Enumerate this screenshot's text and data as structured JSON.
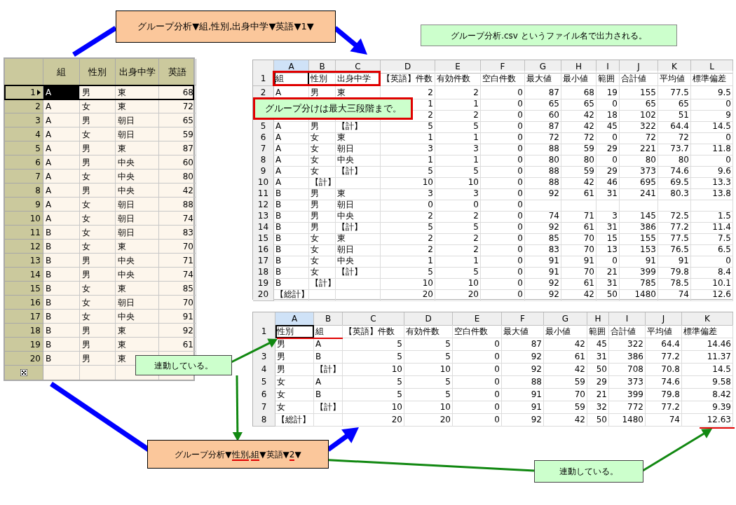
{
  "top_command": {
    "parts": [
      {
        "text": "グループ分析▼組,性別,出身中学▼英語▼1▼",
        "underlined": false
      }
    ]
  },
  "output_note": {
    "text": "グループ分析.csv というファイル名で出力される。"
  },
  "grid": {
    "columns": [
      "組",
      "性別",
      "出身中学",
      "英語"
    ],
    "rows": [
      {
        "number": "1",
        "cells": [
          "A",
          "男",
          "東",
          "68"
        ],
        "selected": true
      },
      {
        "number": "2",
        "cells": [
          "A",
          "女",
          "東",
          "72"
        ],
        "selected": false
      },
      {
        "number": "3",
        "cells": [
          "A",
          "男",
          "朝日",
          "65"
        ],
        "selected": false
      },
      {
        "number": "4",
        "cells": [
          "A",
          "女",
          "朝日",
          "59"
        ],
        "selected": false
      },
      {
        "number": "5",
        "cells": [
          "A",
          "男",
          "東",
          "87"
        ],
        "selected": false
      },
      {
        "number": "6",
        "cells": [
          "A",
          "男",
          "中央",
          "60"
        ],
        "selected": false
      },
      {
        "number": "7",
        "cells": [
          "A",
          "女",
          "中央",
          "80"
        ],
        "selected": false
      },
      {
        "number": "8",
        "cells": [
          "A",
          "男",
          "中央",
          "42"
        ],
        "selected": false
      },
      {
        "number": "9",
        "cells": [
          "A",
          "女",
          "朝日",
          "88"
        ],
        "selected": false
      },
      {
        "number": "10",
        "cells": [
          "A",
          "女",
          "朝日",
          "74"
        ],
        "selected": false
      },
      {
        "number": "11",
        "cells": [
          "B",
          "女",
          "朝日",
          "83"
        ],
        "selected": false
      },
      {
        "number": "12",
        "cells": [
          "B",
          "女",
          "東",
          "70"
        ],
        "selected": false
      },
      {
        "number": "13",
        "cells": [
          "B",
          "男",
          "中央",
          "71"
        ],
        "selected": false
      },
      {
        "number": "14",
        "cells": [
          "B",
          "男",
          "中央",
          "74"
        ],
        "selected": false
      },
      {
        "number": "15",
        "cells": [
          "B",
          "女",
          "東",
          "85"
        ],
        "selected": false
      },
      {
        "number": "16",
        "cells": [
          "B",
          "女",
          "朝日",
          "70"
        ],
        "selected": false
      },
      {
        "number": "17",
        "cells": [
          "B",
          "女",
          "中央",
          "91"
        ],
        "selected": false
      },
      {
        "number": "18",
        "cells": [
          "B",
          "男",
          "東",
          "92"
        ],
        "selected": false
      },
      {
        "number": "19",
        "cells": [
          "B",
          "男",
          "東",
          "61"
        ],
        "selected": false
      },
      {
        "number": "20",
        "cells": [
          "B",
          "男",
          "東",
          null
        ],
        "selected": false
      }
    ]
  },
  "sheet_top": {
    "columns": [
      {
        "label": "A",
        "kind": "text",
        "selected": true
      },
      {
        "label": "B",
        "kind": "text",
        "selected": false
      },
      {
        "label": "C",
        "kind": "text",
        "selected": false
      },
      {
        "label": "D",
        "kind": "number",
        "selected": false
      },
      {
        "label": "E",
        "kind": "number",
        "selected": false
      },
      {
        "label": "F",
        "kind": "number",
        "selected": false
      },
      {
        "label": "G",
        "kind": "number",
        "selected": false
      },
      {
        "label": "H",
        "kind": "number",
        "selected": false
      },
      {
        "label": "I",
        "kind": "number",
        "selected": false
      },
      {
        "label": "J",
        "kind": "number",
        "selected": false
      },
      {
        "label": "K",
        "kind": "number",
        "selected": false
      },
      {
        "label": "L",
        "kind": "number",
        "selected": false
      }
    ],
    "rows": [
      {
        "number": "1",
        "kind": "header",
        "cells": [
          "組",
          "性別",
          "出身中学",
          "【英語】件数",
          "有効件数",
          "空白件数",
          "最大値",
          "最小値",
          "範囲",
          "合計値",
          "平均値",
          "標準偏差"
        ]
      },
      {
        "number": "2",
        "kind": "data",
        "cells": [
          "A",
          "男",
          "東",
          "2",
          "2",
          "0",
          "87",
          "68",
          "19",
          "155",
          "77.5",
          "9.5"
        ]
      },
      {
        "number": null,
        "kind": "data",
        "cells": [
          null,
          null,
          null,
          "1",
          "1",
          "0",
          "65",
          "65",
          "0",
          "65",
          "65",
          "0"
        ]
      },
      {
        "number": null,
        "kind": "data",
        "cells": [
          null,
          null,
          null,
          "2",
          "2",
          "0",
          "60",
          "42",
          "18",
          "102",
          "51",
          "9"
        ]
      },
      {
        "number": "5",
        "kind": "data",
        "cells": [
          "A",
          "男",
          "【計】",
          "5",
          "5",
          "0",
          "87",
          "42",
          "45",
          "322",
          "64.4",
          "14.5"
        ]
      },
      {
        "number": "6",
        "kind": "data",
        "cells": [
          "A",
          "女",
          "東",
          "1",
          "1",
          "0",
          "72",
          "72",
          "0",
          "72",
          "72",
          "0"
        ]
      },
      {
        "number": "7",
        "kind": "data",
        "cells": [
          "A",
          "女",
          "朝日",
          "3",
          "3",
          "0",
          "88",
          "59",
          "29",
          "221",
          "73.7",
          "11.8"
        ]
      },
      {
        "number": "8",
        "kind": "data",
        "cells": [
          "A",
          "女",
          "中央",
          "1",
          "1",
          "0",
          "80",
          "80",
          "0",
          "80",
          "80",
          "0"
        ]
      },
      {
        "number": "9",
        "kind": "data",
        "cells": [
          "A",
          "女",
          "【計】",
          "5",
          "5",
          "0",
          "88",
          "59",
          "29",
          "373",
          "74.6",
          "9.6"
        ]
      },
      {
        "number": "10",
        "kind": "data",
        "cells": [
          "A",
          "【計】",
          null,
          "10",
          "10",
          "0",
          "88",
          "42",
          "46",
          "695",
          "69.5",
          "13.3"
        ]
      },
      {
        "number": "11",
        "kind": "data",
        "cells": [
          "B",
          "男",
          "東",
          "3",
          "3",
          "0",
          "92",
          "61",
          "31",
          "241",
          "80.3",
          "13.8"
        ]
      },
      {
        "number": "12",
        "kind": "data",
        "cells": [
          "B",
          "男",
          "朝日",
          "0",
          "0",
          "0",
          null,
          null,
          null,
          null,
          null,
          null
        ]
      },
      {
        "number": "13",
        "kind": "data",
        "cells": [
          "B",
          "男",
          "中央",
          "2",
          "2",
          "0",
          "74",
          "71",
          "3",
          "145",
          "72.5",
          "1.5"
        ]
      },
      {
        "number": "14",
        "kind": "data",
        "cells": [
          "B",
          "男",
          "【計】",
          "5",
          "5",
          "0",
          "92",
          "61",
          "31",
          "386",
          "77.2",
          "11.4"
        ]
      },
      {
        "number": "15",
        "kind": "data",
        "cells": [
          "B",
          "女",
          "東",
          "2",
          "2",
          "0",
          "85",
          "70",
          "15",
          "155",
          "77.5",
          "7.5"
        ]
      },
      {
        "number": "16",
        "kind": "data",
        "cells": [
          "B",
          "女",
          "朝日",
          "2",
          "2",
          "0",
          "83",
          "70",
          "13",
          "153",
          "76.5",
          "6.5"
        ]
      },
      {
        "number": "17",
        "kind": "data",
        "cells": [
          "B",
          "女",
          "中央",
          "1",
          "1",
          "0",
          "91",
          "91",
          "0",
          "91",
          "91",
          "0"
        ]
      },
      {
        "number": "18",
        "kind": "data",
        "cells": [
          "B",
          "女",
          "【計】",
          "5",
          "5",
          "0",
          "91",
          "70",
          "21",
          "399",
          "79.8",
          "8.4"
        ]
      },
      {
        "number": "19",
        "kind": "data",
        "cells": [
          "B",
          "【計】",
          null,
          "10",
          "10",
          "0",
          "92",
          "61",
          "31",
          "785",
          "78.5",
          "10.1"
        ]
      },
      {
        "number": "20",
        "kind": "data",
        "cells": [
          "【総計】",
          null,
          null,
          "20",
          "20",
          "0",
          "92",
          "42",
          "50",
          "1480",
          "74",
          "12.6"
        ]
      }
    ]
  },
  "limit_note": {
    "text": "グループ分けは最大三段階まで。"
  },
  "sheet_bottom": {
    "columns": [
      {
        "label": "A",
        "kind": "text",
        "selected": true
      },
      {
        "label": "B",
        "kind": "text",
        "selected": false
      },
      {
        "label": "C",
        "kind": "number",
        "selected": false
      },
      {
        "label": "D",
        "kind": "number",
        "selected": false
      },
      {
        "label": "E",
        "kind": "number",
        "selected": false
      },
      {
        "label": "F",
        "kind": "number",
        "selected": false
      },
      {
        "label": "G",
        "kind": "number",
        "selected": false
      },
      {
        "label": "H",
        "kind": "number",
        "selected": false
      },
      {
        "label": "I",
        "kind": "number",
        "selected": false
      },
      {
        "label": "J",
        "kind": "number",
        "selected": false
      },
      {
        "label": "K",
        "kind": "number",
        "selected": false
      }
    ],
    "rows": [
      {
        "number": "1",
        "kind": "header",
        "cells": [
          "性別",
          "組",
          "【英語】件数",
          "有効件数",
          "空白件数",
          "最大値",
          "最小値",
          "範囲",
          "合計値",
          "平均値",
          "標準偏差"
        ]
      },
      {
        "number": null,
        "kind": "data",
        "cells": [
          "男",
          "A",
          "5",
          "5",
          "0",
          "87",
          "42",
          "45",
          "322",
          "64.4",
          "14.46"
        ]
      },
      {
        "number": "3",
        "kind": "data",
        "cells": [
          "男",
          "B",
          "5",
          "5",
          "0",
          "92",
          "61",
          "31",
          "386",
          "77.2",
          "11.37"
        ]
      },
      {
        "number": "4",
        "kind": "data",
        "cells": [
          "男",
          "【計】",
          "10",
          "10",
          "0",
          "92",
          "42",
          "50",
          "708",
          "70.8",
          "14.5"
        ]
      },
      {
        "number": "5",
        "kind": "data",
        "cells": [
          "女",
          "A",
          "5",
          "5",
          "0",
          "88",
          "59",
          "29",
          "373",
          "74.6",
          "9.58"
        ]
      },
      {
        "number": "6",
        "kind": "data",
        "cells": [
          "女",
          "B",
          "5",
          "5",
          "0",
          "91",
          "70",
          "21",
          "399",
          "79.8",
          "8.42"
        ]
      },
      {
        "number": "7",
        "kind": "data",
        "cells": [
          "女",
          "【計】",
          "10",
          "10",
          "0",
          "91",
          "59",
          "32",
          "772",
          "77.2",
          "9.39"
        ]
      },
      {
        "number": "8",
        "kind": "data",
        "cells": [
          "【総計】",
          null,
          "20",
          "20",
          "0",
          "92",
          "42",
          "50",
          "1480",
          "74",
          "12.63"
        ]
      }
    ]
  },
  "link_note_left": {
    "text": "連動している。"
  },
  "bottom_command": {
    "parts": [
      {
        "text": "グループ分析▼",
        "underlined": false
      },
      {
        "text": "性別",
        "underlined": true
      },
      {
        "text": ",",
        "underlined": false
      },
      {
        "text": "組",
        "underlined": true
      },
      {
        "text": "▼英語▼",
        "underlined": false
      },
      {
        "text": "2",
        "underlined": true
      },
      {
        "text": "▼",
        "underlined": false
      }
    ]
  },
  "link_note_right": {
    "text": "連動している。"
  }
}
